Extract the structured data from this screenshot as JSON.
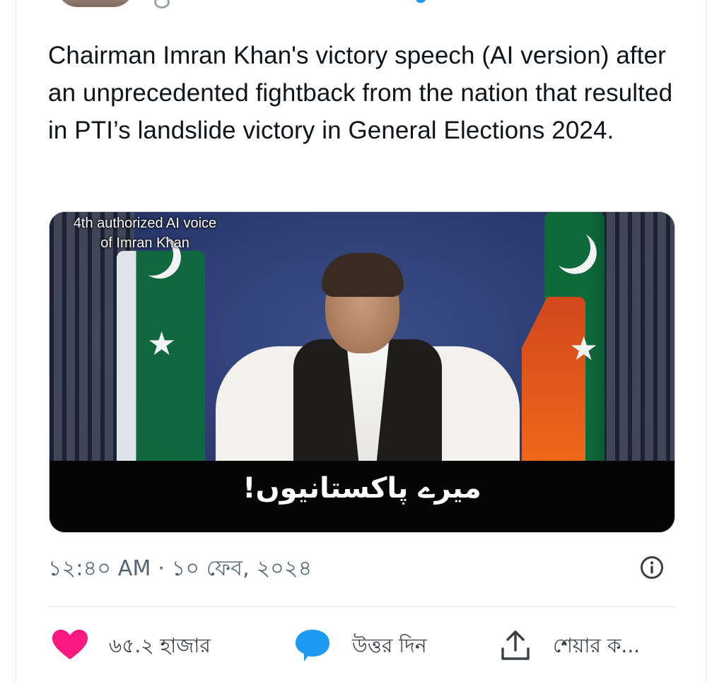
{
  "tweet": {
    "text": "Chairman Imran Khan's victory speech (AI version) after an unprecedented fightback from the nation that resulted in PTI’s landslide victory in General Elections 2024.",
    "media": {
      "watermark_line1": "4th authorized AI voice",
      "watermark_line2": "of Imran Khan",
      "subtitle": "میرے پاکستانیوں!"
    },
    "timestamp": "১২:৪০ AM · ১০ ফেব, ২০২৪"
  },
  "actions": {
    "like_count": "৬৫.২ হাজার",
    "reply_label": "উত্তর দিন",
    "share_label": "শেয়ার ক..."
  },
  "colors": {
    "like": "#f91880",
    "reply": "#1d9bf0",
    "text": "#0f1419",
    "muted": "#536471"
  },
  "icons": {
    "like": "heart-icon",
    "reply": "speech-bubble-icon",
    "share": "share-upload-icon",
    "info": "info-icon"
  }
}
